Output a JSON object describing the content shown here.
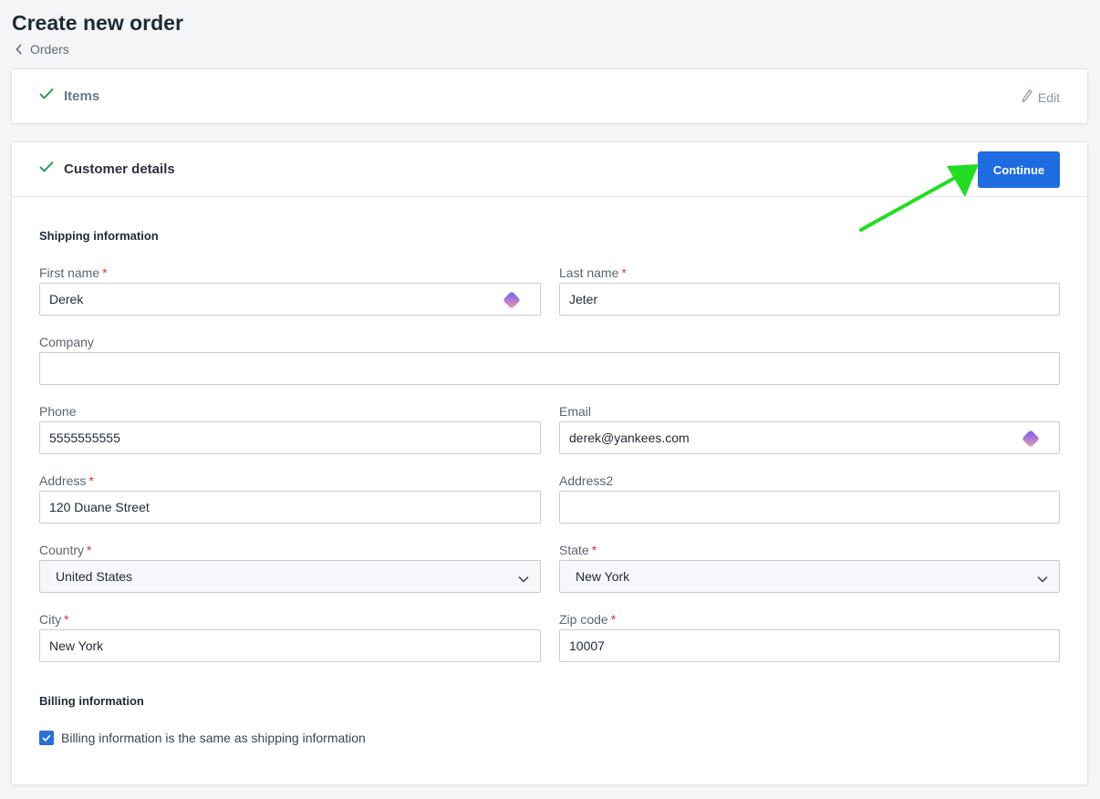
{
  "page": {
    "title": "Create new order",
    "breadcrumb": "Orders"
  },
  "items_step": {
    "title": "Items",
    "edit_label": "Edit"
  },
  "customer_step": {
    "title": "Customer details",
    "continue_label": "Continue"
  },
  "shipping": {
    "heading": "Shipping information",
    "first_name": {
      "label": "First name",
      "value": "Derek",
      "required": true
    },
    "last_name": {
      "label": "Last name",
      "value": "Jeter",
      "required": true
    },
    "company": {
      "label": "Company",
      "value": ""
    },
    "phone": {
      "label": "Phone",
      "value": "5555555555"
    },
    "email": {
      "label": "Email",
      "value": "derek@yankees.com"
    },
    "address": {
      "label": "Address",
      "value": "120 Duane Street",
      "required": true
    },
    "address2": {
      "label": "Address2",
      "value": ""
    },
    "country": {
      "label": "Country",
      "value": "United States",
      "required": true
    },
    "state": {
      "label": "State",
      "value": "New York",
      "required": true
    },
    "city": {
      "label": "City",
      "value": "New York",
      "required": true
    },
    "zip": {
      "label": "Zip code",
      "value": "10007",
      "required": true
    }
  },
  "billing": {
    "heading": "Billing information",
    "same_as_shipping_label": "Billing information is the same as shipping information",
    "same_as_shipping_checked": true
  },
  "colors": {
    "primary": "#1f6ce0",
    "check": "#2f9e52",
    "required": "#dd3333",
    "annotation_arrow": "#22dd22"
  },
  "icons": {
    "breadcrumb": "chevron-left-icon",
    "step_done": "checkmark-icon",
    "edit": "pencil-icon",
    "select": "chevron-down-icon",
    "autofill": "autofill-extension-icon"
  }
}
